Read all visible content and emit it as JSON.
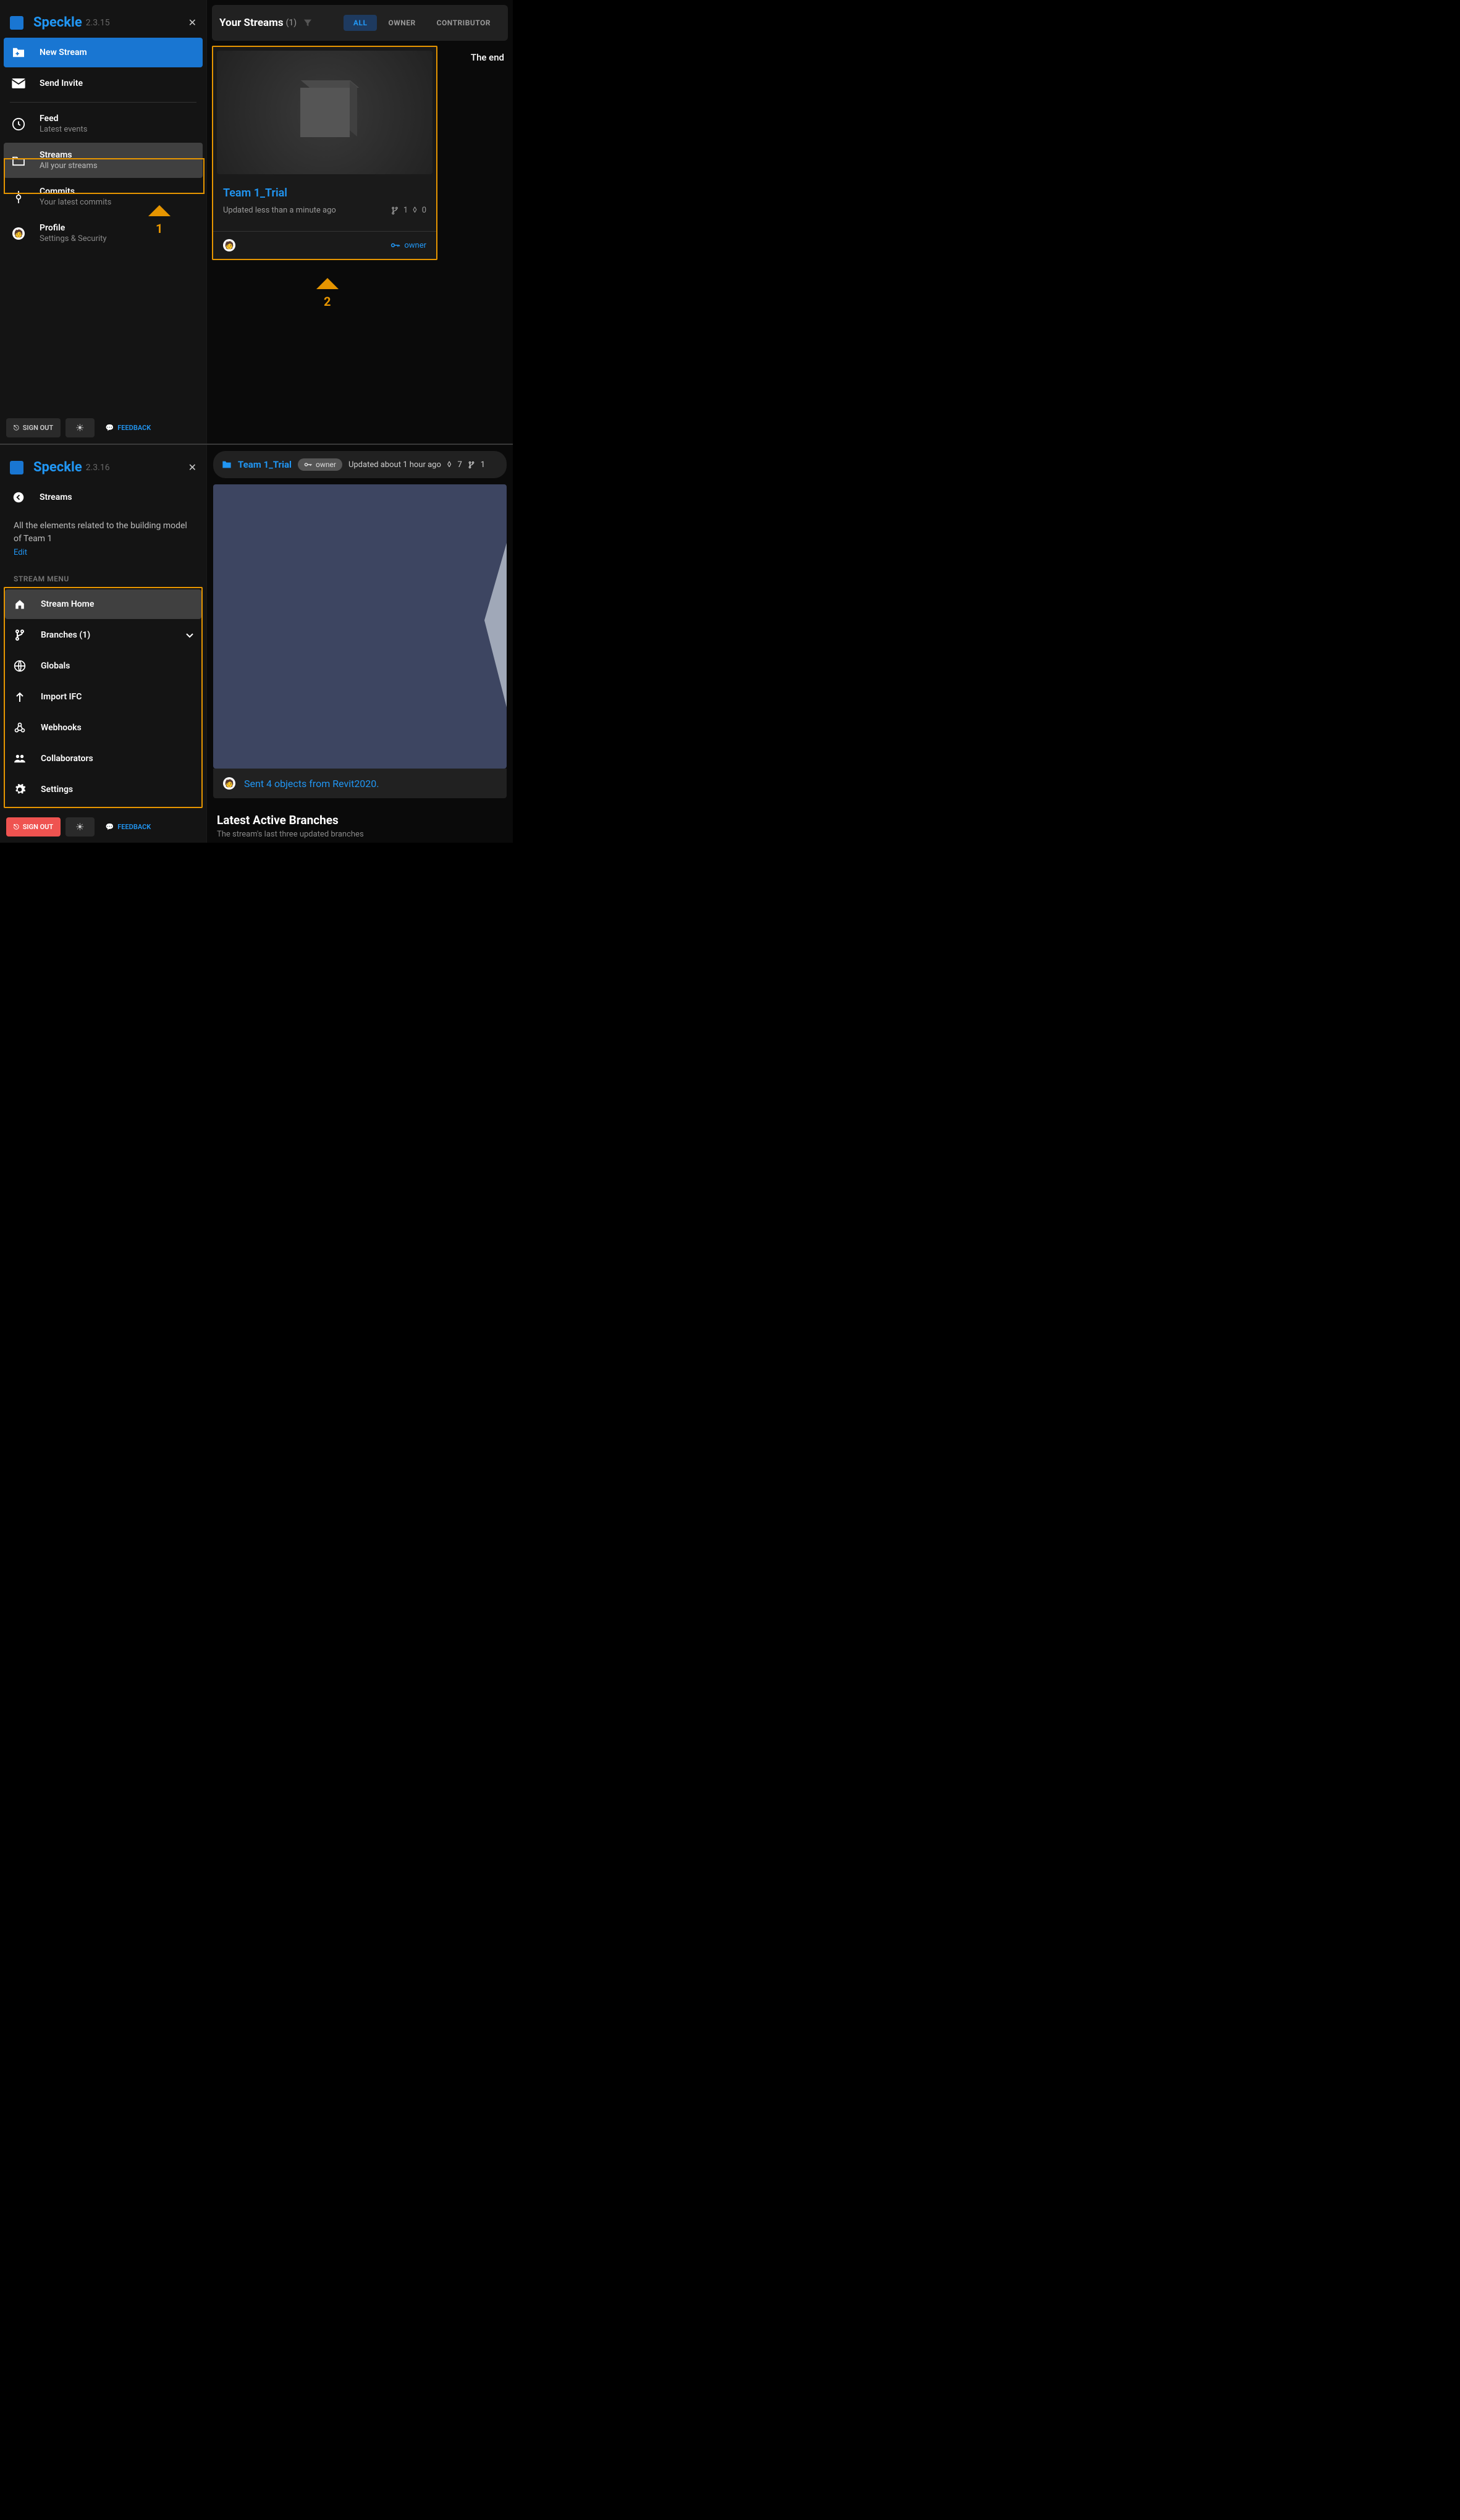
{
  "panel1": {
    "brand": "Speckle",
    "version": "2.3.15",
    "new_stream": "New Stream",
    "send_invite": "Send Invite",
    "feed": {
      "title": "Feed",
      "sub": "Latest events"
    },
    "streams": {
      "title": "Streams",
      "sub": "All your streams"
    },
    "commits": {
      "title": "Commits",
      "sub": "Your latest commits"
    },
    "profile": {
      "title": "Profile",
      "sub": "Settings & Security"
    },
    "signout": "SIGN OUT",
    "feedback": "FEEDBACK",
    "topbar": {
      "title": "Your Streams",
      "count": "(1)",
      "tabs": {
        "all": "ALL",
        "owner": "OWNER",
        "contributor": "CONTRIBUTOR"
      }
    },
    "card": {
      "title": "Team 1_Trial",
      "updated": "Updated less than a minute ago",
      "branches": "1",
      "commits": "0",
      "owner": "owner"
    },
    "end": "The end",
    "annot1": "1",
    "annot2": "2"
  },
  "panel2": {
    "brand": "Speckle",
    "version": "2.3.16",
    "streams_label": "Streams",
    "desc": "All the elements related to the building model of Team 1",
    "edit": "Edit",
    "section": "STREAM MENU",
    "menu": {
      "home": "Stream Home",
      "branches": "Branches (1)",
      "globals": "Globals",
      "import": "Import IFC",
      "webhooks": "Webhooks",
      "collaborators": "Collaborators",
      "settings": "Settings"
    },
    "signout": "SIGN OUT",
    "feedback": "FEEDBACK",
    "topbar": {
      "name": "Team 1_Trial",
      "owner": "owner",
      "updated": "Updated about 1 hour ago",
      "commits": "7",
      "branches": "1"
    },
    "commit_msg": "Sent 4 objects from Revit2020.",
    "latest": {
      "title": "Latest Active Branches",
      "sub": "The stream's last three updated branches"
    }
  }
}
